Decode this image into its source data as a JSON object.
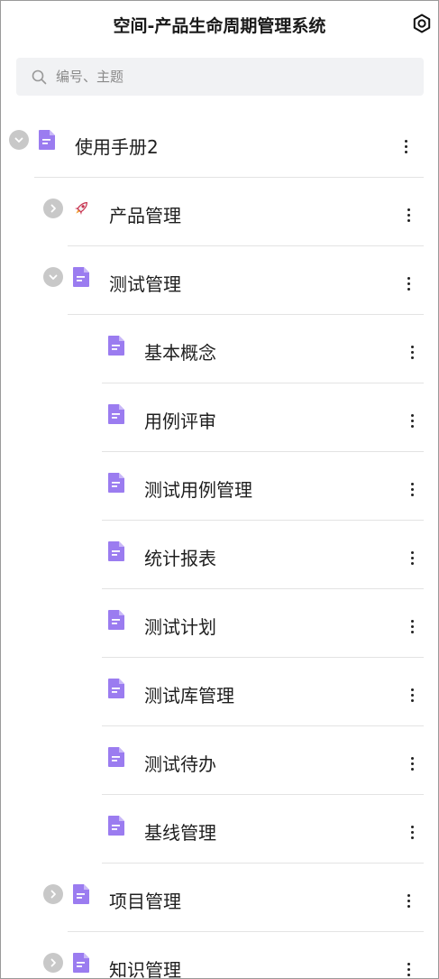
{
  "app": {
    "title": "空间-产品生命周期管理系统"
  },
  "search": {
    "placeholder": "编号、主题",
    "value": ""
  },
  "tree": [
    {
      "label": "使用手册2",
      "level": 0,
      "expanded": true,
      "icon": "document-icon",
      "toggle": true
    },
    {
      "label": "产品管理",
      "level": 1,
      "expanded": false,
      "icon": "rocket-icon",
      "toggle": true
    },
    {
      "label": "测试管理",
      "level": 1,
      "expanded": true,
      "icon": "document-icon",
      "toggle": true
    },
    {
      "label": "基本概念",
      "level": 2,
      "icon": "document-icon",
      "toggle": false
    },
    {
      "label": "用例评审",
      "level": 2,
      "icon": "document-icon",
      "toggle": false
    },
    {
      "label": "测试用例管理",
      "level": 2,
      "icon": "document-icon",
      "toggle": false
    },
    {
      "label": "统计报表",
      "level": 2,
      "icon": "document-icon",
      "toggle": false
    },
    {
      "label": "测试计划",
      "level": 2,
      "icon": "document-icon",
      "toggle": false
    },
    {
      "label": "测试库管理",
      "level": 2,
      "icon": "document-icon",
      "toggle": false
    },
    {
      "label": "测试待办",
      "level": 2,
      "icon": "document-icon",
      "toggle": false
    },
    {
      "label": "基线管理",
      "level": 2,
      "icon": "document-icon",
      "toggle": false
    },
    {
      "label": "项目管理",
      "level": 1,
      "expanded": false,
      "icon": "document-icon",
      "toggle": true
    },
    {
      "label": "知识管理",
      "level": 1,
      "expanded": false,
      "icon": "document-icon",
      "toggle": true
    }
  ],
  "colors": {
    "doc_icon": "#9b7cf0",
    "toggle": "#c8c8c8",
    "divider": "#e3e3e3",
    "search_bg": "#f1f2f4"
  }
}
